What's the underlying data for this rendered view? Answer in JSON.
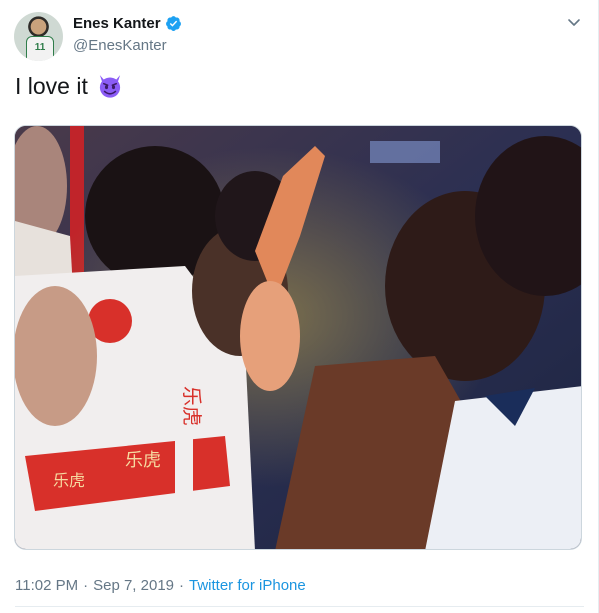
{
  "tweet": {
    "display_name": "Enes Kanter",
    "handle": "@EnesKanter",
    "verified": true,
    "text": "I love it",
    "emoji": "smiling-imp-emoji",
    "time": "11:02 PM",
    "date": "Sep 7, 2019",
    "separator": "·",
    "source": "Twitter for iPhone"
  },
  "avatar": {
    "jersey_number": "11"
  },
  "media": {
    "overlay_text": [
      "乐虎",
      "乐虎",
      "乐虎"
    ]
  },
  "colors": {
    "link": "#1b95e0",
    "secondary_text": "#657786",
    "verified": "#1da1f2",
    "emoji": "#8b5cf6"
  },
  "icons": [
    "verified-badge-icon",
    "chevron-down-icon",
    "smiling-imp-emoji"
  ]
}
